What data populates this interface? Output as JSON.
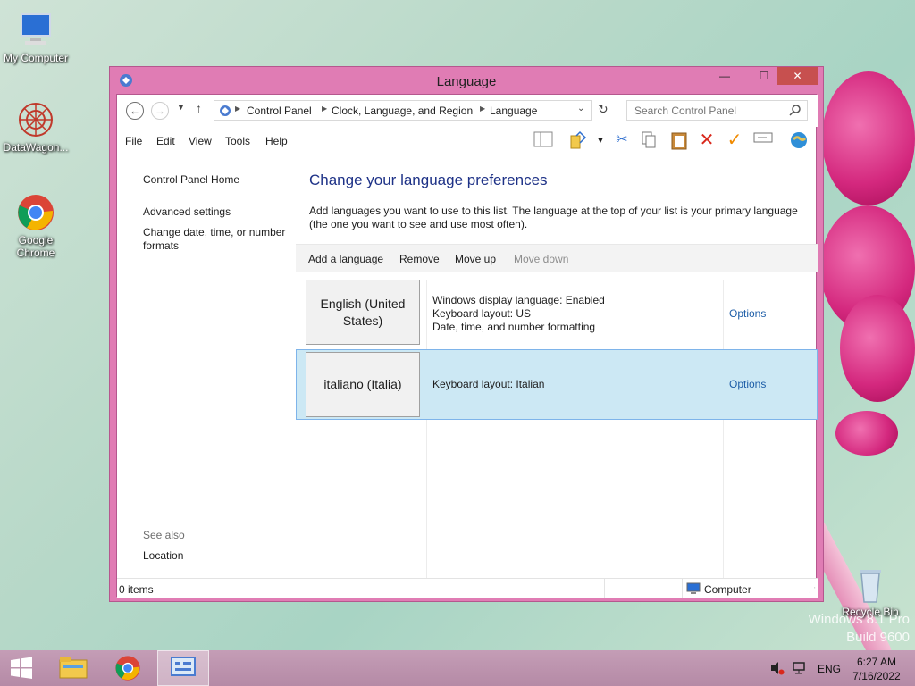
{
  "desktop": {
    "icons": [
      {
        "label": "My Computer"
      },
      {
        "label": "DataWagon..."
      },
      {
        "label": "Google Chrome"
      },
      {
        "label": "Recycle Bin"
      }
    ],
    "watermark": {
      "line1": "Windows 8.1 Pro",
      "line2": "Build 9600"
    }
  },
  "window": {
    "title": "Language",
    "controls": {
      "minimize": "—",
      "maximize": "☐",
      "close": "✕"
    },
    "address": {
      "crumbs": [
        "Control Panel",
        "Clock, Language, and Region",
        "Language"
      ]
    },
    "search": {
      "placeholder": "Search Control Panel"
    },
    "menu": [
      "File",
      "Edit",
      "View",
      "Tools",
      "Help"
    ],
    "toolbar_icons": [
      "pane-toggle-icon",
      "folder-check-icon",
      "dropdown-arrow-icon",
      "cut-icon",
      "copy-icon",
      "paste-icon",
      "delete-icon",
      "properties-icon",
      "rename-icon",
      "world-icon"
    ],
    "left_pane": {
      "home": "Control Panel Home",
      "links": [
        "Advanced settings",
        "Change date, time, or number formats"
      ],
      "see_also_title": "See also",
      "see_also_links": [
        "Location"
      ]
    },
    "main": {
      "heading": "Change your language preferences",
      "description": "Add languages you want to use to this list. The language at the top of your list is your primary language (the one you want to see and use most often).",
      "commands": {
        "add": "Add a language",
        "remove": "Remove",
        "up": "Move up",
        "down": "Move down"
      },
      "languages": [
        {
          "name": "English (United States)",
          "details": [
            "Windows display language: Enabled",
            "Keyboard layout: US",
            "Date, time, and number formatting"
          ],
          "options": "Options"
        },
        {
          "name": "italiano (Italia)",
          "details": [
            "Keyboard layout: Italian"
          ],
          "options": "Options"
        }
      ]
    },
    "status": {
      "items": "0 items",
      "location": "Computer"
    }
  },
  "taskbar": {
    "lang": "ENG",
    "time": "6:27 AM",
    "date": "7/16/2022"
  },
  "colors": {
    "accent": "#e07cb4",
    "link": "#1e5ea8",
    "heading": "#1e3287",
    "selection": "#cce8f4"
  }
}
